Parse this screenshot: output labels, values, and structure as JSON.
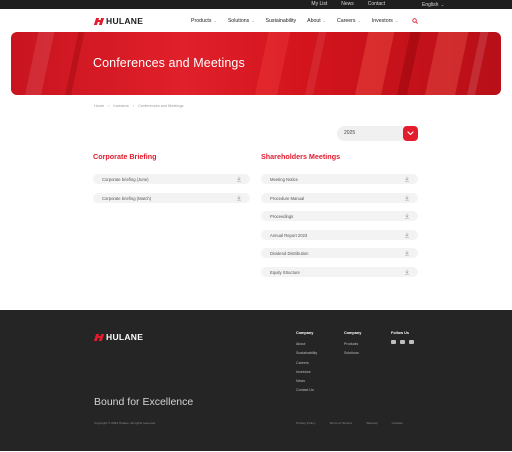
{
  "topbar": {
    "links": [
      "My List",
      "News",
      "Contact"
    ],
    "language": "English"
  },
  "brand": {
    "name": "HULANE",
    "accent": "#e21b2d"
  },
  "nav": {
    "items": [
      {
        "label": "Products"
      },
      {
        "label": "Solutions"
      },
      {
        "label": "Sustainability"
      },
      {
        "label": "About"
      },
      {
        "label": "Careers"
      },
      {
        "label": "Investors"
      }
    ]
  },
  "hero": {
    "title": "Conferences and Meetings"
  },
  "breadcrumb": [
    "Home",
    "Investors",
    "Conferences and Meetings"
  ],
  "year_select": {
    "value": "2025"
  },
  "corporate": {
    "title": "Corporate Briefing",
    "docs": [
      "Corporate briefing (June)",
      "Corporate briefing (March)"
    ]
  },
  "shareholders": {
    "title": "Shareholders Meetings",
    "docs": [
      "Meeting Notice",
      "Procedure Manual",
      "Proceedings",
      "Annual Report 2023",
      "Dividend Distribution",
      "Equity Structure"
    ]
  },
  "footer": {
    "columns": [
      {
        "heading": "Company",
        "links": [
          "About",
          "Sustainability",
          "Careers",
          "Investors",
          "News",
          "Contact Us"
        ]
      },
      {
        "heading": "Company",
        "links": [
          "Products",
          "Solutions"
        ]
      }
    ],
    "follow_heading": "Follow Us",
    "social": [
      "linkedin-icon",
      "wechat-icon",
      "youtube-icon"
    ],
    "tagline": "Bound for Excellence",
    "copyright": "Copyright © 2024 Hulane. All rights reserved.",
    "legal": [
      "Privacy Policy",
      "Terms of Service",
      "Sitemap",
      "Cookies"
    ]
  }
}
